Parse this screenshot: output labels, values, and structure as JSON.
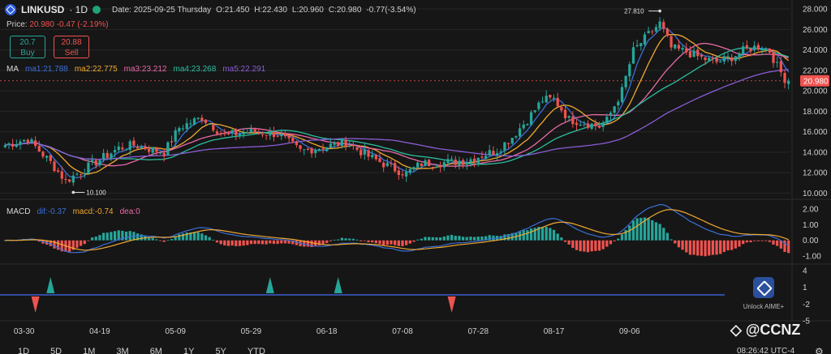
{
  "header": {
    "symbol": "LINKUSD",
    "timeframe": "· 1D",
    "date": "Date: 2025-09-25 Thursday",
    "open": "O:21.450",
    "high": "H:22.430",
    "low": "L:20.960",
    "close": "C:20.980",
    "change": "-0.77(-3.54%)"
  },
  "price_line": {
    "label": "Price:",
    "value": "20.980 -0.47 (-2.19%)"
  },
  "buy": {
    "price": "20.7",
    "label": "Buy"
  },
  "sell": {
    "price": "20.88",
    "label": "Sell"
  },
  "ma_legend": {
    "title": "MA",
    "ma1": "ma1:21.788",
    "ma2": "ma2:22.775",
    "ma3": "ma3:23.212",
    "ma4": "ma4:23.268",
    "ma5": "ma5:22.291"
  },
  "macd_legend": {
    "title": "MACD",
    "dif": "dif:-0.37",
    "macd": "macd:-0.74",
    "dea": "dea:0"
  },
  "time_ranges": [
    "1D",
    "5D",
    "1M",
    "3M",
    "6M",
    "1Y",
    "5Y",
    "YTD"
  ],
  "clock": "08:26:42 UTC-4",
  "aime_label": "Unlock AIME+",
  "watermark": "◇ @CCNZ",
  "colors": {
    "up": "#26a69a",
    "down": "#ef5350",
    "ma1": "#3b6fd6",
    "ma2": "#f0a830",
    "ma3": "#e86aa6",
    "ma4": "#2bbfa0",
    "ma5": "#8a5cd6",
    "dif": "#3b6fd6",
    "macd": "#f0a830"
  },
  "chart_data": [
    {
      "type": "candlestick",
      "title": "LINKUSD · 1D",
      "x_ticks": [
        "03-30",
        "04-19",
        "05-09",
        "05-29",
        "06-18",
        "07-08",
        "07-28",
        "08-17",
        "09-06"
      ],
      "y_ticks": [
        "10.000",
        "12.000",
        "14.000",
        "16.000",
        "18.000",
        "20.000",
        "22.000",
        "24.000",
        "26.000",
        "28.000"
      ],
      "ylim": [
        9.4,
        28.4
      ],
      "last_price_label": "20.980",
      "annotations": {
        "high": "27.810",
        "low": "10.100"
      },
      "anchors": [
        [
          0,
          14.7
        ],
        [
          6,
          15.3
        ],
        [
          12,
          13.0
        ],
        [
          16,
          11.2
        ],
        [
          22,
          12.6
        ],
        [
          30,
          14.4
        ],
        [
          34,
          14.7
        ],
        [
          42,
          14.0
        ],
        [
          46,
          16.4
        ],
        [
          52,
          17.4
        ],
        [
          58,
          15.6
        ],
        [
          64,
          16.0
        ],
        [
          72,
          15.8
        ],
        [
          78,
          14.1
        ],
        [
          84,
          14.5
        ],
        [
          90,
          15.0
        ],
        [
          96,
          13.6
        ],
        [
          102,
          12.5
        ],
        [
          106,
          11.9
        ],
        [
          110,
          12.9
        ],
        [
          116,
          13.0
        ],
        [
          122,
          13.2
        ],
        [
          126,
          13.7
        ],
        [
          130,
          14.2
        ],
        [
          134,
          15.5
        ],
        [
          138,
          17.2
        ],
        [
          142,
          19.1
        ],
        [
          145,
          19.2
        ],
        [
          149,
          17.2
        ],
        [
          153,
          16.9
        ],
        [
          157,
          16.5
        ],
        [
          159,
          17.1
        ],
        [
          163,
          20.0
        ],
        [
          166,
          23.9
        ],
        [
          170,
          25.5
        ],
        [
          173,
          26.6
        ],
        [
          176,
          24.2
        ],
        [
          180,
          23.8
        ],
        [
          184,
          23.2
        ],
        [
          188,
          22.8
        ],
        [
          192,
          23.3
        ],
        [
          196,
          24.1
        ],
        [
          200,
          24.4
        ],
        [
          202,
          23.9
        ],
        [
          204,
          22.4
        ],
        [
          206,
          21.2
        ],
        [
          207,
          20.98
        ]
      ],
      "ma_periods": [
        5,
        10,
        20,
        30,
        60
      ]
    },
    {
      "type": "macd",
      "y_ticks": [
        "2.00",
        "1.00",
        "0.00",
        "-1.00"
      ],
      "ylim": [
        -1.3,
        2.3
      ],
      "dif": -0.37,
      "macd": -0.74,
      "dea": 0
    },
    {
      "type": "signals",
      "y_ticks": [
        "4",
        "1",
        "-2",
        "-5"
      ],
      "buy_signals": [
        "04-06",
        "06-03",
        "06-21"
      ],
      "sell_signals": [
        "04-02",
        "07-21"
      ]
    }
  ]
}
